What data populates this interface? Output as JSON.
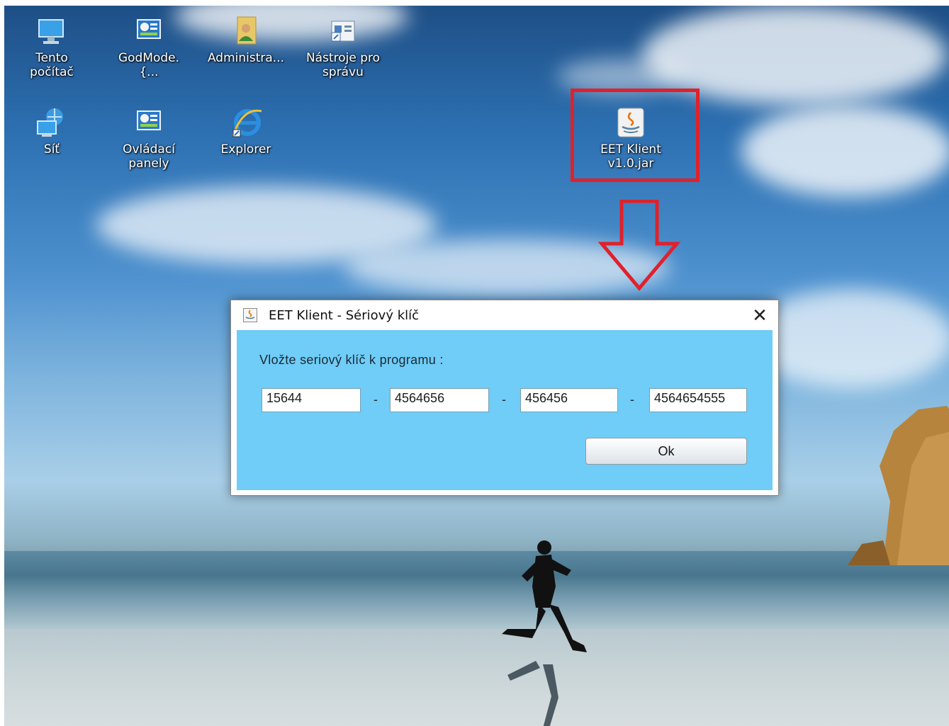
{
  "desktop": {
    "icons": [
      {
        "label": "Tento počítač",
        "icon": "computer-icon"
      },
      {
        "label": "GodMode.{...",
        "icon": "control-panel-icon"
      },
      {
        "label": "Administra...",
        "icon": "user-folder-icon"
      },
      {
        "label": "Nástroje pro správu",
        "icon": "admin-tools-icon"
      },
      {
        "label": "Síť",
        "icon": "network-icon"
      },
      {
        "label": "Ovládací panely",
        "icon": "control-panel-icon"
      },
      {
        "label": "Explorer",
        "icon": "internet-explorer-icon"
      },
      {
        "label": "EET Klient v1.0.jar",
        "icon": "java-jar-icon"
      }
    ],
    "highlight_color": "#e0212b",
    "arrow_color": "#e0212b"
  },
  "dialog": {
    "title": "EET Klient - Sériový klíč",
    "close_glyph": "✕",
    "prompt": "Vložte seriový klíč k programu :",
    "fields": [
      "15644",
      "4564656",
      "456456",
      "4564654555"
    ],
    "separator": "-",
    "ok_label": "Ok",
    "body_color": "#6fcdf7"
  }
}
